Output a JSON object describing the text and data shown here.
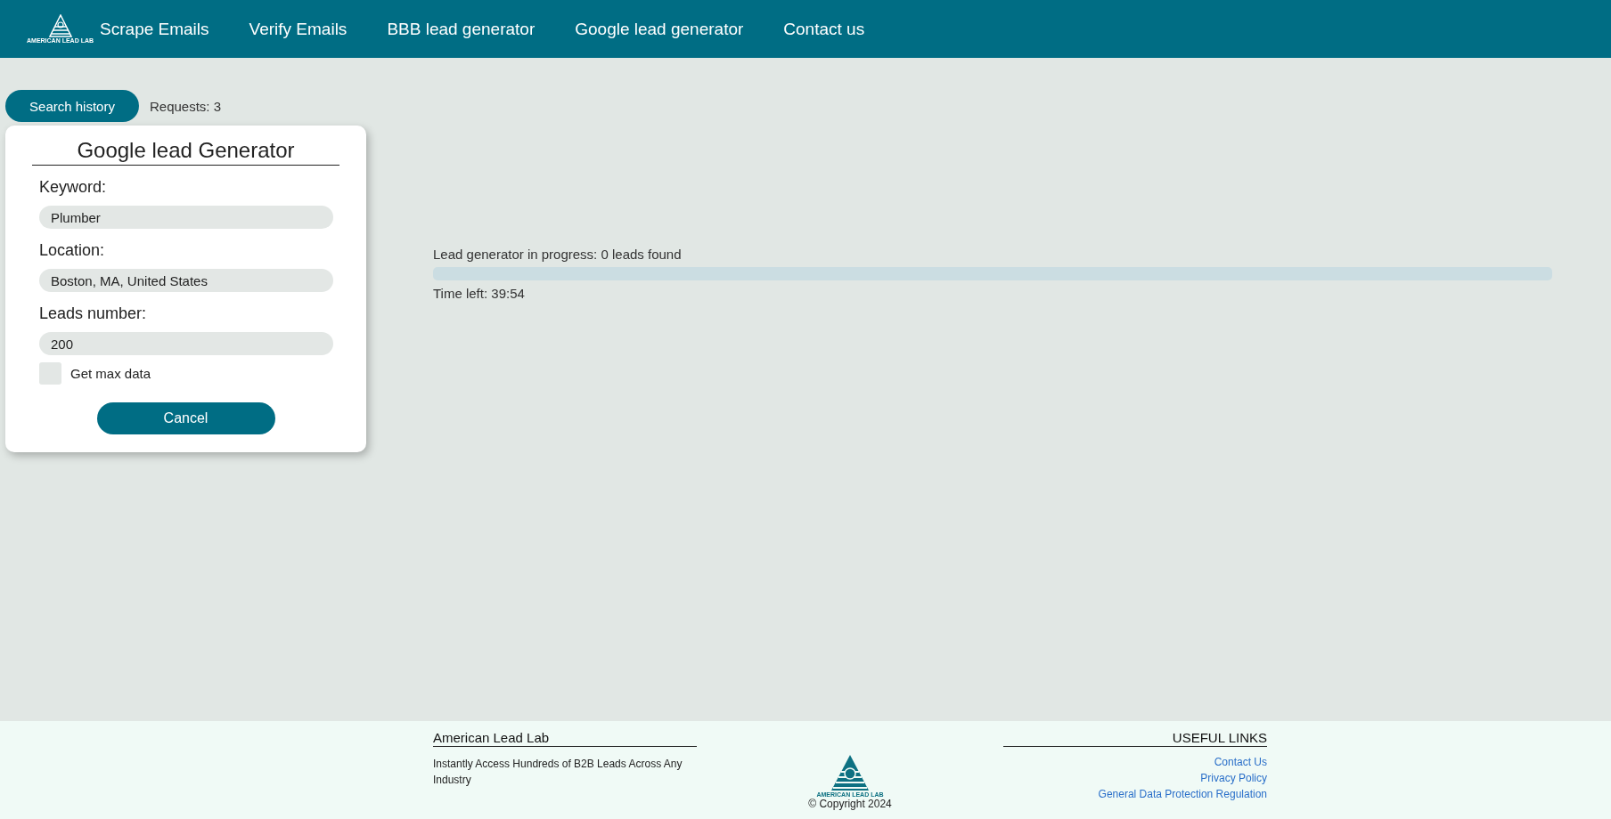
{
  "header": {
    "logo_text": "AMERICAN LEAD LAB",
    "nav": [
      {
        "label": "Scrape Emails"
      },
      {
        "label": "Verify Emails"
      },
      {
        "label": "BBB lead generator"
      },
      {
        "label": "Google lead generator"
      },
      {
        "label": "Contact us"
      }
    ]
  },
  "toolbar": {
    "button": "Search history",
    "requests": "Requests: 3"
  },
  "form": {
    "title": "Google lead Generator",
    "fields": [
      {
        "label": "Keyword:",
        "value": "Plumber"
      },
      {
        "label": "Location:",
        "value": "Boston, MA, United States"
      },
      {
        "label": "Leads number:",
        "value": "200"
      }
    ],
    "checkbox": {
      "label": "Get max data",
      "checked": false
    },
    "button": "Cancel"
  },
  "progress": {
    "status": "Lead generator in progress: 0 leads found",
    "level": 0,
    "time_left": "Time left: 39:54"
  },
  "footer": {
    "about": {
      "title": "American Lead Lab",
      "text": "Instantly Access Hundreds of B2B Leads Across Any Industry"
    },
    "logo_text": "AMERICAN LEAD LAB",
    "copyright": "© Copyright 2024",
    "links": {
      "title": "USEFUL LINKS",
      "items": [
        "Contact Us",
        "Privacy Policy",
        "General Data Protection Regulation"
      ]
    }
  }
}
